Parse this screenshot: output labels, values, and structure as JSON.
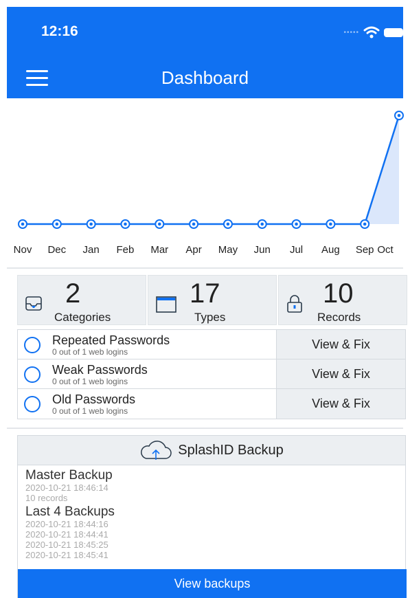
{
  "status": {
    "time": "12:16"
  },
  "header": {
    "title": "Dashboard"
  },
  "chart_data": {
    "type": "area",
    "categories": [
      "Nov",
      "Dec",
      "Jan",
      "Feb",
      "Mar",
      "Apr",
      "May",
      "Jun",
      "Jul",
      "Aug",
      "Sep",
      "Oct"
    ],
    "values": [
      0,
      0,
      0,
      0,
      0,
      0,
      0,
      0,
      0,
      0,
      0,
      10
    ],
    "ylim": [
      0,
      10
    ],
    "grid": false,
    "color": "#1071f2",
    "fill": "#dbe7fb"
  },
  "stats": [
    {
      "value": "2",
      "label": "Categories",
      "icon": "inbox-icon"
    },
    {
      "value": "17",
      "label": "Types",
      "icon": "folder-icon"
    },
    {
      "value": "10",
      "label": "Records",
      "icon": "lock-icon"
    }
  ],
  "security": [
    {
      "title": "Repeated Passwords",
      "subtitle": "0 out of 1 web logins",
      "action": "View & Fix"
    },
    {
      "title": "Weak Passwords",
      "subtitle": "0 out of 1 web logins",
      "action": "View & Fix"
    },
    {
      "title": "Old Passwords",
      "subtitle": "0 out of 1 web logins",
      "action": "View & Fix"
    }
  ],
  "backup": {
    "title": "SplashID Backup",
    "master_heading": "Master Backup",
    "master_date": "2020-10-21 18:46:14",
    "master_records": "10 records",
    "last_heading": "Last 4 Backups",
    "last_dates": [
      "2020-10-21 18:44:16",
      "2020-10-21 18:44:41",
      "2020-10-21 18:45:25",
      "2020-10-21 18:45:41"
    ],
    "view_label": "View backups"
  },
  "colors": {
    "accent": "#1071f2",
    "panel": "#eceff2"
  }
}
